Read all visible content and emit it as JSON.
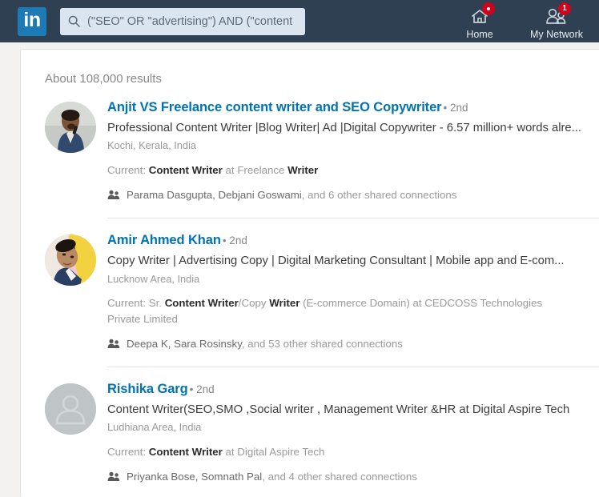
{
  "topbar": {
    "logo_text": "in",
    "logo_name": "linkedin-logo",
    "search": {
      "value": "(\"SEO\" OR \"advertising\") AND (\"content",
      "placeholder": "Search",
      "icon": "search-icon"
    },
    "nav": [
      {
        "label": "Home",
        "icon": "home-icon",
        "badge": "",
        "badge_type": "dot"
      },
      {
        "label": "My Network",
        "icon": "my-network-icon",
        "badge": "1",
        "badge_type": "number"
      }
    ]
  },
  "results": {
    "count_text": "About 108,000 results",
    "shared_icon": "people-icon",
    "items": [
      {
        "name": "Anjit VS Freelance content writer and SEO Copywriter",
        "degree": "• 2nd",
        "headline": "Professional Content Writer |Blog Writer| Ad |Digital Copywriter - 6.57 million+ words alre...",
        "location": "Kochi, Kerala, India",
        "current_prefix": "Current: ",
        "current_parts": [
          {
            "text": "Content Writer",
            "style": "bold"
          },
          {
            "text": " at ",
            "style": "muted"
          },
          {
            "text": "Freelance ",
            "style": "muted"
          },
          {
            "text": "Writer",
            "style": "bold"
          }
        ],
        "shared_names": "Parama Dasgupta, Debjani Goswami",
        "shared_rest": ", and 6 other shared connections",
        "avatar_type": "photo-man-blue-shirt",
        "avatar_name": "avatar-anjit-vs"
      },
      {
        "name": "Amir Ahmed Khan",
        "degree": "• 2nd",
        "headline": "Copy Writer | Advertising Copy | Digital Marketing Consultant | Mobile app and E-com...",
        "location": "Lucknow Area, India",
        "current_prefix": "Current: ",
        "current_parts": [
          {
            "text": "Sr. ",
            "style": "muted"
          },
          {
            "text": "Content Writer",
            "style": "bold"
          },
          {
            "text": "/Copy ",
            "style": "muted"
          },
          {
            "text": "Writer",
            "style": "bold"
          },
          {
            "text": " (E-commerce Domain) at CEDCOSS Technologies Private Limited",
            "style": "muted"
          }
        ],
        "shared_names": "Deepa K, Sara Rosinsky",
        "shared_rest": ", and 53 other shared connections",
        "avatar_type": "photo-man-yellow-bg",
        "avatar_name": "avatar-amir-ahmed-khan"
      },
      {
        "name": "Rishika Garg",
        "degree": "• 2nd",
        "headline": "Content Writer(SEO,SMO ,Social writer , Management Writer &HR at Digital Aspire Tech",
        "location": "Ludhiana Area, India",
        "current_prefix": "Current: ",
        "current_parts": [
          {
            "text": "Content Writer",
            "style": "bold"
          },
          {
            "text": " at Digital Aspire Tech",
            "style": "muted"
          }
        ],
        "shared_names": "Priyanka Bose, Somnath Pal",
        "shared_rest": ", and 4 other shared connections",
        "avatar_type": "placeholder",
        "avatar_name": "avatar-rishika-garg"
      }
    ]
  },
  "colors": {
    "nav_bg": "#2e4052",
    "brand_blue": "#0073b1",
    "logo_blue": "#1c7ab6",
    "search_bg": "#dbe5ef",
    "badge_red": "#d0021b",
    "page_bg": "#f3f2f0",
    "card_bg": "#ffffff"
  }
}
